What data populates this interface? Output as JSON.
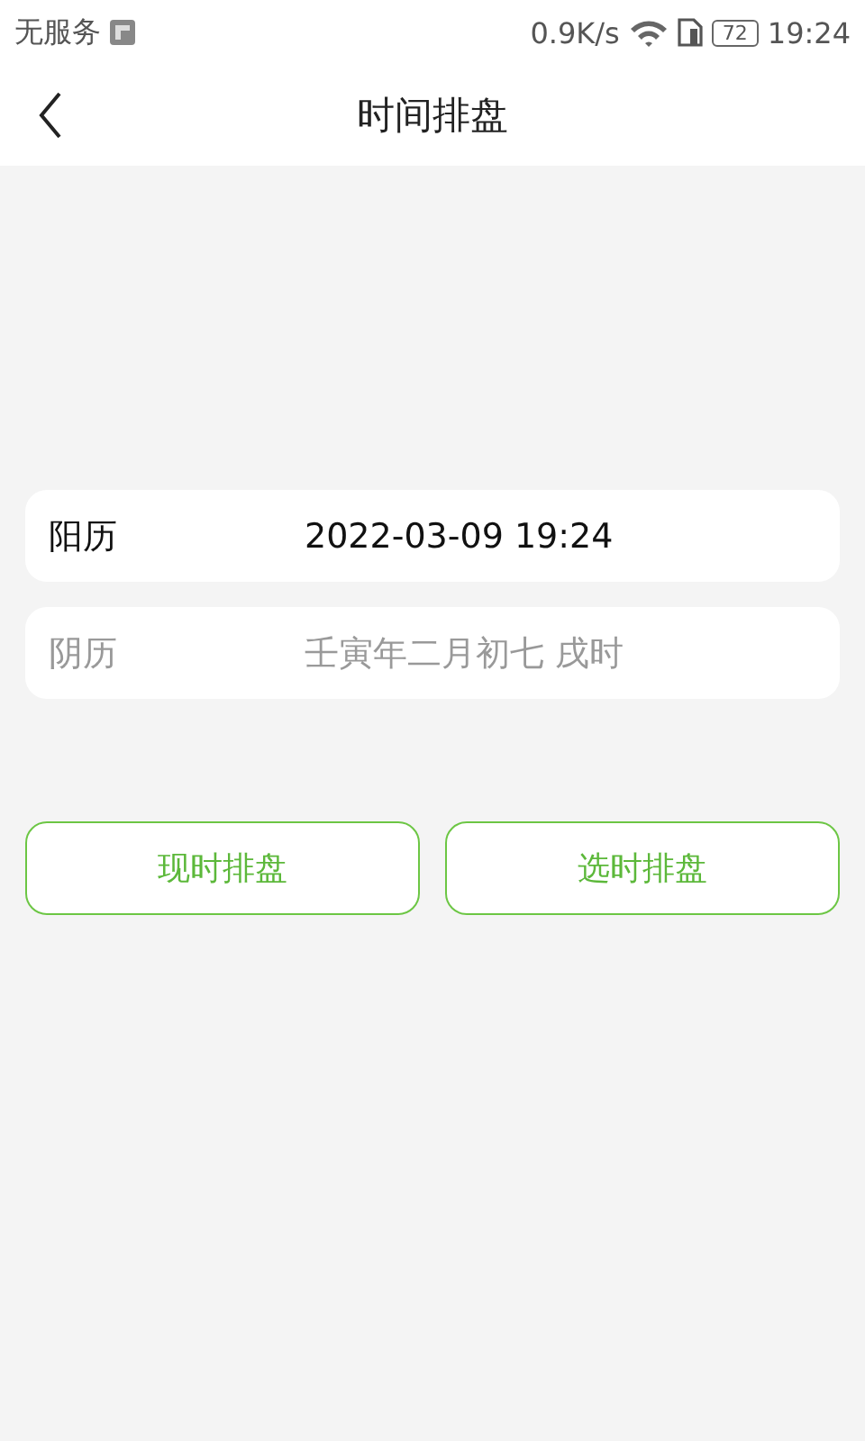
{
  "status_bar": {
    "carrier": "无服务",
    "speed": "0.9K/s",
    "battery": "72",
    "time": "19:24"
  },
  "header": {
    "title": "时间排盘"
  },
  "calendars": [
    {
      "label": "阳历",
      "value": "2022-03-09 19:24",
      "selected": true
    },
    {
      "label": "阴历",
      "value": "壬寅年二月初七 戌时",
      "selected": false
    }
  ],
  "buttons": [
    "现时排盘",
    "选时排盘"
  ]
}
